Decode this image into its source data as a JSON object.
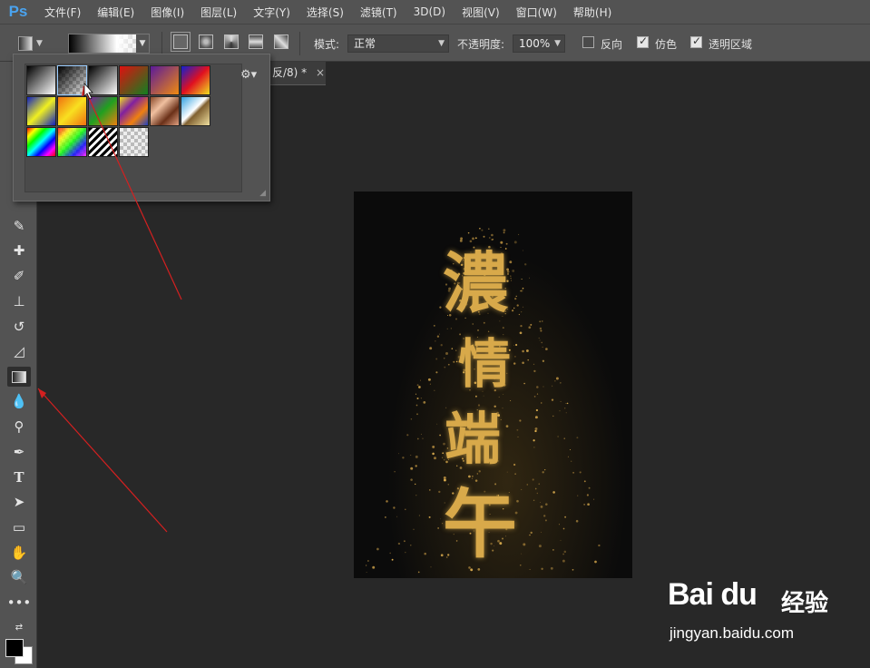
{
  "app": {
    "logo": "Ps"
  },
  "menu": [
    "文件(F)",
    "编辑(E)",
    "图像(I)",
    "图层(L)",
    "文字(Y)",
    "选择(S)",
    "滤镜(T)",
    "3D(D)",
    "视图(V)",
    "窗口(W)",
    "帮助(H)"
  ],
  "options": {
    "mode_label": "模式:",
    "mode_value": "正常",
    "opacity_label": "不透明度:",
    "opacity_value": "100%",
    "reverse_label": "反向",
    "reverse_checked": false,
    "dither_label": "仿色",
    "dither_checked": true,
    "transparency_label": "透明区域",
    "transparency_checked": true
  },
  "document": {
    "tab_label": "反/8) *",
    "close": "×",
    "artwork_text": [
      "濃",
      "情",
      "端",
      "午"
    ]
  },
  "gradient_presets": [
    "foreground-to-background",
    "foreground-to-transparent",
    "black-white",
    "red-green",
    "violet-orange",
    "blue-red-yellow",
    "blue-yellow-blue",
    "orange-yellow-orange",
    "violet-green-orange",
    "yellow-violet-orange-blue",
    "copper",
    "chrome",
    "spectrum",
    "transparent-rainbow",
    "transparent-stripes",
    "neutral-density"
  ],
  "tools": [
    "rectangle-marquee",
    "lasso",
    "eyedropper",
    "healing-brush",
    "brush",
    "clone-stamp",
    "history-brush",
    "eraser",
    "gradient",
    "blur",
    "dodge",
    "pen",
    "type",
    "path-selection",
    "rectangle",
    "hand",
    "zoom",
    "more"
  ],
  "watermark": {
    "logo": "Bai du",
    "suffix": "经验",
    "url": "jingyan.baidu.com"
  }
}
